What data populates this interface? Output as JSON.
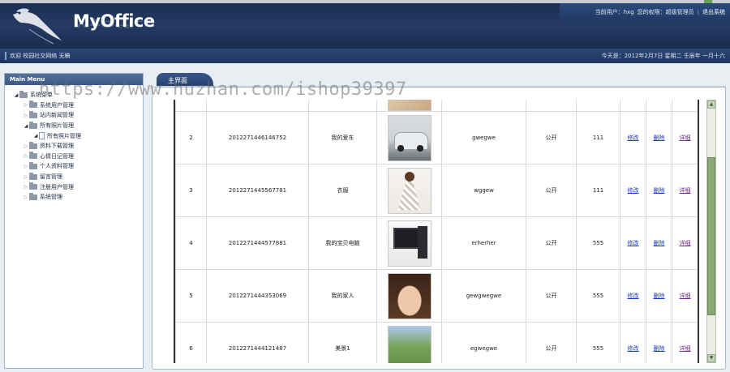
{
  "app": {
    "logo": "MyOffice",
    "user_panel": {
      "current_user": "当前用户：hxg",
      "role": "您的权限：超级管理员",
      "logout": "退出系统"
    },
    "welcome": "欢迎  校园社交网络  无稿",
    "date_info": "今天是：2012年2月7日  星期二  壬辰年  一月十六"
  },
  "sidebar": {
    "title": "Main Menu",
    "root": "系统菜单",
    "items": [
      {
        "label": "系统用户管理"
      },
      {
        "label": "站内新闻管理"
      },
      {
        "label": "所有照片管理"
      },
      {
        "label": "所有照片管理"
      },
      {
        "label": "资料下载管理"
      },
      {
        "label": "心情日记管理"
      },
      {
        "label": "个人资料管理"
      },
      {
        "label": "留言管理"
      },
      {
        "label": "注册用户管理"
      },
      {
        "label": "系统管理"
      }
    ]
  },
  "tab": {
    "label": "主界面"
  },
  "table": {
    "actions": {
      "edit": "修改",
      "delete": "删除",
      "detail": "详细"
    },
    "rows": [
      {
        "no": "2",
        "code": "2012271446146752",
        "title": "我的爱车",
        "image": "car",
        "user": "gwegwe",
        "status": "公开",
        "views": "111"
      },
      {
        "no": "3",
        "code": "2012271445567781",
        "title": "衣服",
        "image": "dress",
        "user": "wggew",
        "status": "公开",
        "views": "111"
      },
      {
        "no": "4",
        "code": "2012271444577881",
        "title": "我的宝贝电脑",
        "image": "pc",
        "user": "erherher",
        "status": "公开",
        "views": "555"
      },
      {
        "no": "5",
        "code": "2012271444353069",
        "title": "我的家人",
        "image": "woman",
        "user": "gewgwegwe",
        "status": "公开",
        "views": "555"
      },
      {
        "no": "6",
        "code": "2012271444121487",
        "title": "美景1",
        "image": "park",
        "user": "egwegwe",
        "status": "公开",
        "views": "555"
      }
    ]
  },
  "scrollbar": {
    "up": "▲",
    "down": "▼"
  },
  "watermark": "https://www.huzhan.com/ishop39397"
}
